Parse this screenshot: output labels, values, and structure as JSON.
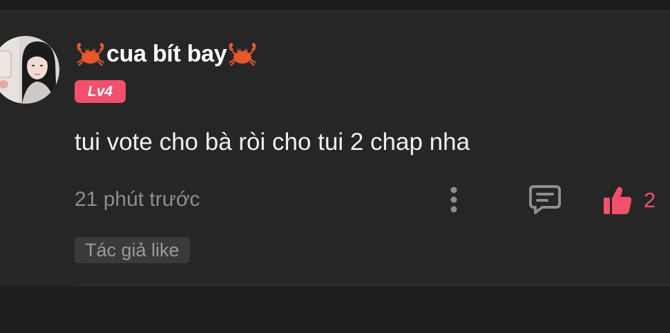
{
  "comment": {
    "user": {
      "name": "cua bít bay",
      "level_badge": "Lv4",
      "name_decoration_icon": "crab-icon"
    },
    "text": "tui vote cho bà ròi cho tui 2 chap nha",
    "timestamp": "21 phút trước",
    "actions": {
      "more_icon": "vertical-dots-icon",
      "reply_icon": "comment-bubble-icon",
      "like_icon": "thumbs-up-icon",
      "like_count": "2"
    },
    "author_like_tag": "Tác giả like"
  },
  "colors": {
    "accent": "#f2506c",
    "background": "#262626",
    "text_primary": "#ffffff",
    "text_secondary": "#8e8e8e"
  }
}
